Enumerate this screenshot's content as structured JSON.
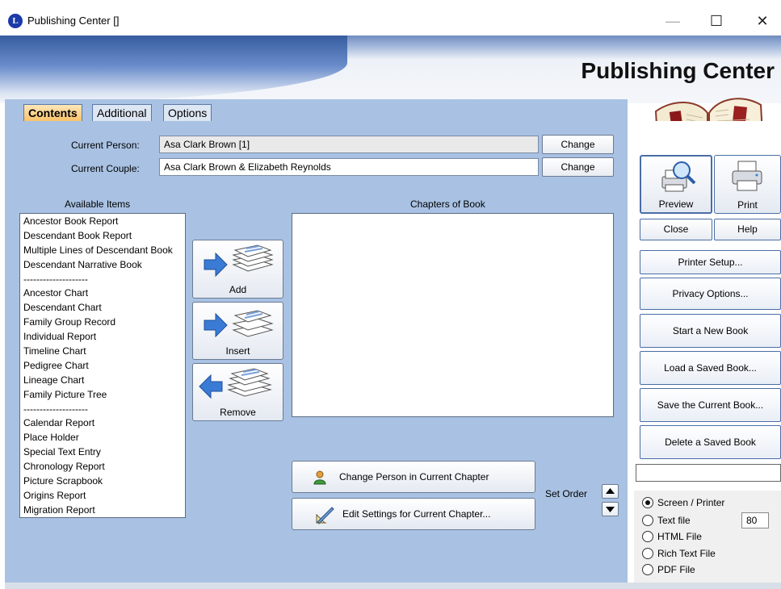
{
  "window": {
    "title": "Publishing Center []",
    "icon_letter": "L",
    "minimize": "—",
    "maximize": "☐",
    "close": "✕"
  },
  "banner": {
    "title": "Publishing Center"
  },
  "tabs": [
    {
      "label": "Contents",
      "active": true
    },
    {
      "label": "Additional",
      "active": false
    },
    {
      "label": "Options",
      "active": false
    }
  ],
  "current_person": {
    "label": "Current Person:",
    "value": "Asa Clark Brown [1]",
    "button": "Change"
  },
  "current_couple": {
    "label": "Current Couple:",
    "value": "Asa Clark Brown & Elizabeth Reynolds",
    "button": "Change"
  },
  "available": {
    "header": "Available Items",
    "items": [
      "Ancestor Book Report",
      "Descendant Book Report",
      "Multiple Lines of Descendant Book",
      "Descendant Narrative Book",
      "--------------------",
      "Ancestor Chart",
      "Descendant Chart",
      "Family Group Record",
      "Individual Report",
      "Timeline Chart",
      "Pedigree Chart",
      "Lineage Chart",
      "Family Picture Tree",
      "--------------------",
      "Calendar Report",
      "Place Holder",
      "Special Text Entry",
      "Chronology Report",
      "Picture Scrapbook",
      "Origins Report",
      "Migration Report"
    ]
  },
  "actions": {
    "add": "Add",
    "insert": "Insert",
    "remove": "Remove"
  },
  "chapters": {
    "header": "Chapters of Book",
    "items": []
  },
  "chapter_buttons": {
    "change_person": "Change Person in Current Chapter",
    "edit_settings": "Edit Settings for Current Chapter..."
  },
  "set_order": {
    "label": "Set Order"
  },
  "right": {
    "preview": "Preview",
    "print": "Print",
    "close": "Close",
    "help": "Help",
    "printer_setup": "Printer Setup...",
    "privacy_options": "Privacy Options...",
    "start_new_book": "Start a New Book",
    "load_saved_book": "Load a Saved Book...",
    "save_current_book": "Save the Current Book...",
    "delete_saved_book": "Delete a Saved Book",
    "output_options": [
      {
        "label": "Screen / Printer",
        "selected": true
      },
      {
        "label": "Text file",
        "selected": false
      },
      {
        "label": "HTML File",
        "selected": false
      },
      {
        "label": "Rich Text File",
        "selected": false
      },
      {
        "label": "PDF File",
        "selected": false
      }
    ],
    "text_width": "80"
  }
}
